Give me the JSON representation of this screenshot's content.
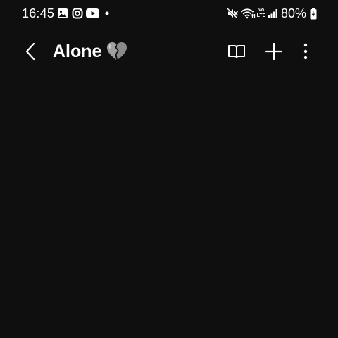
{
  "status_bar": {
    "time": "16:45",
    "left_icons": [
      "gallery-icon",
      "instagram-icon",
      "youtube-icon",
      "notification-dot-icon"
    ],
    "right_icons": [
      "mute-icon",
      "wifi-icon",
      "volte-icon",
      "signal-icon",
      "battery-charging-icon"
    ],
    "volte_label_top": "Vo",
    "volte_label_bottom": "LTE",
    "battery_percent": "80%"
  },
  "app_bar": {
    "back_icon": "chevron-left-icon",
    "title": "Alone",
    "title_emoji": "broken-heart-icon",
    "actions": [
      "book-icon",
      "plus-icon",
      "more-vertical-icon"
    ]
  },
  "colors": {
    "background": "#0f0f0f",
    "text": "#ffffff",
    "divider": "#2c2c2c"
  }
}
